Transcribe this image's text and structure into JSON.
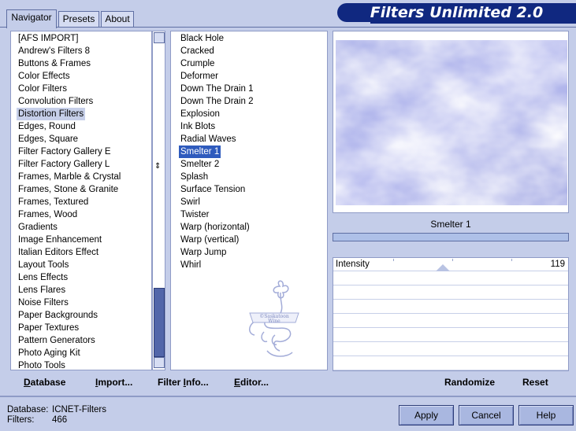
{
  "tabs": [
    {
      "label": "Navigator"
    },
    {
      "label": "Presets"
    },
    {
      "label": "About"
    }
  ],
  "banner": {
    "title": "Filters Unlimited 2.0"
  },
  "categories": [
    "[AFS IMPORT]",
    "Andrew's Filters 8",
    "Buttons & Frames",
    "Color Effects",
    "Color Filters",
    "Convolution Filters",
    "Distortion Filters",
    "Edges, Round",
    "Edges, Square",
    "Filter Factory Gallery E",
    "Filter Factory Gallery L",
    "Frames, Marble & Crystal",
    "Frames, Stone & Granite",
    "Frames, Textured",
    "Frames, Wood",
    "Gradients",
    "Image Enhancement",
    "Italian Editors Effect",
    "Layout Tools",
    "Lens Effects",
    "Lens Flares",
    "Noise Filters",
    "Paper Backgrounds",
    "Paper Textures",
    "Pattern Generators",
    "Photo Aging Kit",
    "Photo Tools"
  ],
  "selected_category": "Distortion Filters",
  "filters": [
    "Black Hole",
    "Cracked",
    "Crumple",
    "Deformer",
    "Down The Drain 1",
    "Down The Drain 2",
    "Explosion",
    "Ink Blots",
    "Radial Waves",
    "Smelter 1",
    "Smelter 2",
    "Splash",
    "Surface Tension",
    "Swirl",
    "Twister",
    "Warp (horizontal)",
    "Warp (vertical)",
    "Warp Jump",
    "Whirl"
  ],
  "selected_filter": "Smelter 1",
  "watermark": {
    "text_line1": "©Saskatoon",
    "text_line2": "Wine"
  },
  "preview": {
    "filter_name": "Smelter 1"
  },
  "parameters": [
    {
      "label": "Intensity",
      "value": "119",
      "level": 0.467
    }
  ],
  "actions": {
    "database": "Database",
    "import": "Import...",
    "filter_info": "Filter Info...",
    "editor": "Editor...",
    "randomize": "Randomize",
    "reset": "Reset"
  },
  "buttons": {
    "apply": "Apply",
    "cancel": "Cancel",
    "help": "Help"
  },
  "status": {
    "database_label": "Database:",
    "database_value": "ICNET-Filters",
    "filters_label": "Filters:",
    "filters_value": "466"
  },
  "colors": {
    "background": "#c4cde9",
    "banner": "#102880",
    "selection": "#2f5bbd"
  }
}
